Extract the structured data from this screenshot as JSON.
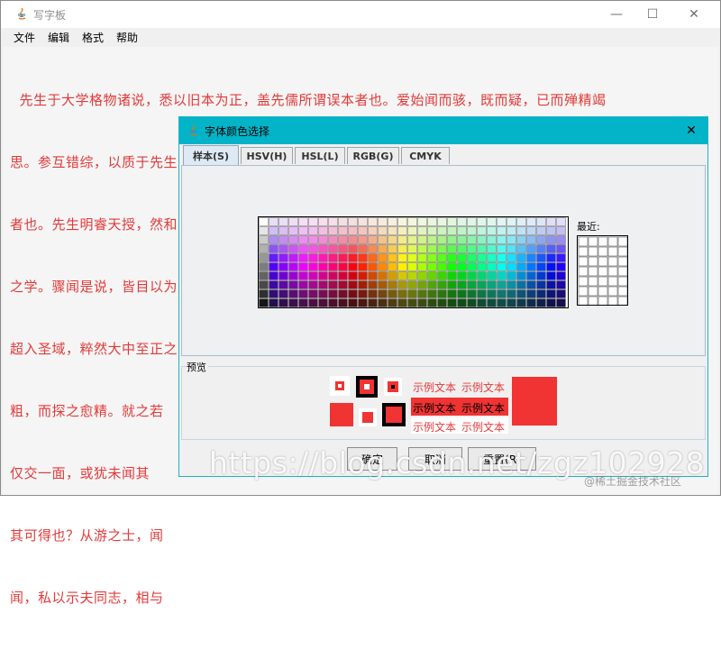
{
  "window": {
    "title": "写字板",
    "minimize": "—",
    "maximize": "☐",
    "close": "✕"
  },
  "menu": [
    "文件",
    "编辑",
    "格式",
    "帮助"
  ],
  "text_lines": [
    "  先生于大学格物诸说，悉以旧本为正，盖先儒所谓误本者也。爱始闻而骇，既而疑，已而殚精竭",
    "思。参互错综，以质于先生，然后知先生之说，若水之寒，若火之热，断断乎百世以俟圣人而不惑",
    "者也。先生明睿天授，然和乐坦易，不事边幅。人见其少时豪迈不羁，又尝泛滥于词章，出入二氏",
    "之学。骤闻是说，皆目以为立异好奇，漫不省究。不知先生居夷三载，处困养静，精一之功，固已",
    "超入圣域，粹然大中至正之归矣。",
    "粗，而探之愈精。就之若",
    "仅交一面，或犹未闻其",
    "其可得也？从游之士，闻",
    "闻，私以示夫同志，相与"
  ],
  "dialog": {
    "title": "字体颜色选择",
    "close": "✕",
    "tabs": [
      "样本(S)",
      "HSV(H)",
      "HSL(L)",
      "RGB(G)",
      "CMYK"
    ],
    "active_tab": "样本(S)",
    "recent_label": "最近:",
    "preview_label": "预览",
    "sample_text": "示例文本",
    "buttons": {
      "ok": "确定",
      "cancel": "取消",
      "reset": "重置(R)"
    },
    "selected_color": "#f03333"
  },
  "watermark": "https://blog.csdn.net/zgz102928",
  "watermark_small": "@稀土掘金技术社区"
}
